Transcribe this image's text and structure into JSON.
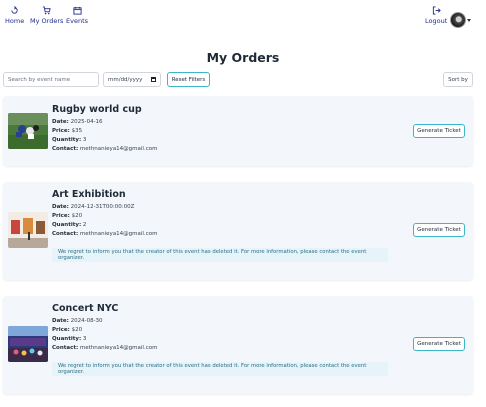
{
  "nav": {
    "home_label": "Home",
    "orders_label": "My Orders",
    "events_label": "Events",
    "logout_label": "Logout"
  },
  "page_title": "My Orders",
  "filters": {
    "search_placeholder": "Search by event name",
    "date_placeholder": "mm/dd/yyyy",
    "reset_label": "Reset Filters",
    "sort_label": "Sort by"
  },
  "labels": {
    "date": "Date:",
    "price": "Price:",
    "quantity": "Quantity:",
    "contact": "Contact:",
    "generate_ticket": "Generate Ticket"
  },
  "orders": [
    {
      "title": "Rugby world cup",
      "date": "2025-04-16",
      "price": "$35",
      "quantity": "3",
      "contact": "methnanieya14@gmail.com",
      "notice": ""
    },
    {
      "title": "Art Exhibition",
      "date": "2024-12-31T00:00:00Z",
      "price": "$20",
      "quantity": "2",
      "contact": "methnanieya14@gmail.com",
      "notice": "We regret to inform you that the creator of this event has deleted it. For more information, please contact the event organizer."
    },
    {
      "title": "Concert NYC",
      "date": "2024-08-30",
      "price": "$20",
      "quantity": "3",
      "contact": "methnanieya14@gmail.com",
      "notice": "We regret to inform you that the creator of this event has deleted it. For more information, please contact the event organizer."
    }
  ],
  "colors": {
    "nav": "#1e2b8a",
    "accent": "#3bb6c8",
    "card_bg": "#f3f7fb",
    "notice_bg": "#e6f4f9",
    "notice_text": "#2b6c85"
  },
  "icons": {
    "home": "home-icon",
    "orders": "cart-icon",
    "events": "calendar-icon",
    "logout": "logout-icon"
  }
}
